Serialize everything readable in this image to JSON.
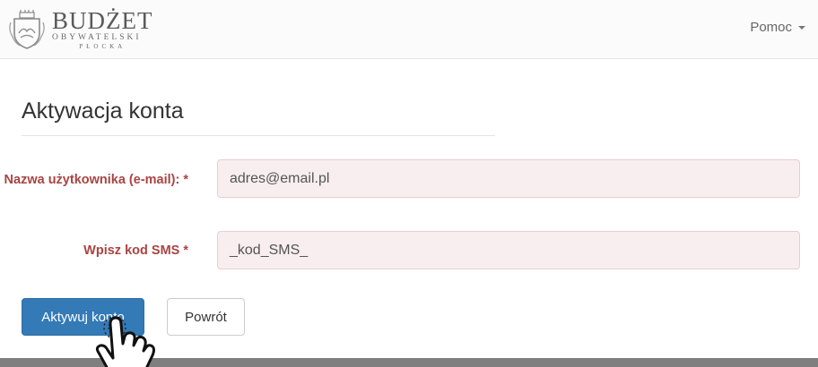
{
  "brand": {
    "title": "BUDŻET",
    "subtitle_1": "OBYWATELSKI",
    "subtitle_2": "PŁOCKA",
    "emblem_icon": "city-crest-icon"
  },
  "nav": {
    "help_label": "Pomoc"
  },
  "form": {
    "title": "Aktywacja konta",
    "username_label": "Nazwa użytkownika (e-mail): *",
    "username_value": "adres@email.pl",
    "sms_label": "Wpisz kod SMS *",
    "sms_value": "_kod_SMS_",
    "activate_button": "Aktywuj konto",
    "back_button": "Powrót"
  },
  "colors": {
    "primary": "#337ab7",
    "error_label": "#a94442",
    "error_input_bg": "#f8eeef",
    "error_input_border": "#ebccd1"
  },
  "overlay": {
    "cursor_icon": "hand-pointer-icon"
  }
}
